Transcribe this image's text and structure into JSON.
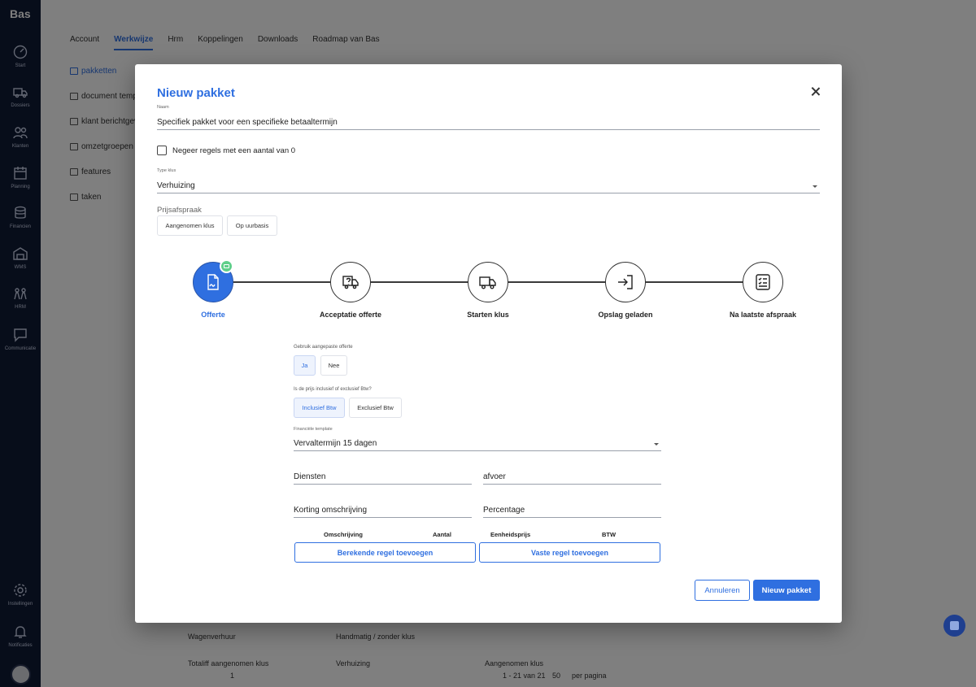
{
  "app": {
    "logo": "Bas"
  },
  "nav": {
    "items": [
      {
        "label": "Start",
        "icon": "dashboard-icon"
      },
      {
        "label": "Dossiers",
        "icon": "truck-icon"
      },
      {
        "label": "Klanten",
        "icon": "people-icon"
      },
      {
        "label": "Planning",
        "icon": "calendar-icon"
      },
      {
        "label": "Financien",
        "icon": "coins-icon"
      },
      {
        "label": "WMS",
        "icon": "warehouse-icon"
      },
      {
        "label": "HRM",
        "icon": "team-icon"
      },
      {
        "label": "Communicatie",
        "icon": "chat-icon"
      }
    ],
    "bottom": [
      {
        "label": "Instellingen",
        "icon": "gear-icon"
      },
      {
        "label": "Notificaties",
        "icon": "bell-icon"
      }
    ]
  },
  "background": {
    "tabs": [
      "Account",
      "Werkwijze",
      "Hrm",
      "Koppelingen",
      "Downloads",
      "Roadmap van Bas"
    ],
    "side": [
      "pakketten",
      "document templ",
      "klant berichtgev",
      "omzetgroepen",
      "features",
      "taken"
    ],
    "rows": [
      {
        "name": "Wagenverhuur",
        "type": "Handmatig / zonder klus",
        "extra": ""
      },
      {
        "name": "Totaliff aangenomen klus",
        "type": "Verhuizing",
        "extra": "Aangenomen klus"
      }
    ],
    "pager": {
      "page": "1",
      "range": "1 - 21 van 21",
      "per_page_value": "50",
      "per_page_label": "per pagina"
    }
  },
  "modal": {
    "title": "Nieuw pakket",
    "name": {
      "label": "Naam",
      "value": "Specifiek pakket voor een specifieke betaaltermijn"
    },
    "ignore_checkbox": {
      "label": "Negeer regels met een aantal van 0",
      "checked": false
    },
    "job_type": {
      "label": "Type klus",
      "value": "Verhuizing"
    },
    "price_agreement": {
      "label": "Prijsafspraak",
      "options": [
        "Aangenomen klus",
        "Op uurbasis"
      ]
    },
    "steps": [
      {
        "label": "Offerte",
        "icon": "document-signature-icon",
        "active": true
      },
      {
        "label": "Acceptatie offerte",
        "icon": "truck-question-icon",
        "active": false
      },
      {
        "label": "Starten klus",
        "icon": "truck-icon",
        "active": false
      },
      {
        "label": "Opslag geladen",
        "icon": "sign-in-icon",
        "active": false
      },
      {
        "label": "Na laatste afspraak",
        "icon": "checklist-icon",
        "active": false
      }
    ],
    "custom_quote": {
      "label": "Gebruik aangepaste offerte",
      "options": [
        "Ja",
        "Nee"
      ],
      "selected": "Ja"
    },
    "vat": {
      "label": "Is de prijs inclusief of exclusief Btw?",
      "options": [
        "Inclusief Btw",
        "Exclusief Btw"
      ],
      "selected": "Inclusief Btw"
    },
    "financial_template": {
      "label": "Financiële template",
      "value": "Vervaltermijn 15 dagen"
    },
    "fields": {
      "services": "Diensten",
      "disposal": "afvoer",
      "discount_description": "Korting omschrijving",
      "percentage": "Percentage"
    },
    "table_headers": [
      "Omschrijving",
      "Aantal",
      "Eenheidsprijs",
      "BTW"
    ],
    "add_calculated": "Berekende regel toevoegen",
    "add_fixed": "Vaste regel toevoegen",
    "cancel": "Annuleren",
    "submit": "Nieuw pakket"
  },
  "colors": {
    "accent": "#2f6fe0",
    "nav_bg": "#0f1a35",
    "badge": "#5fcf8a"
  }
}
